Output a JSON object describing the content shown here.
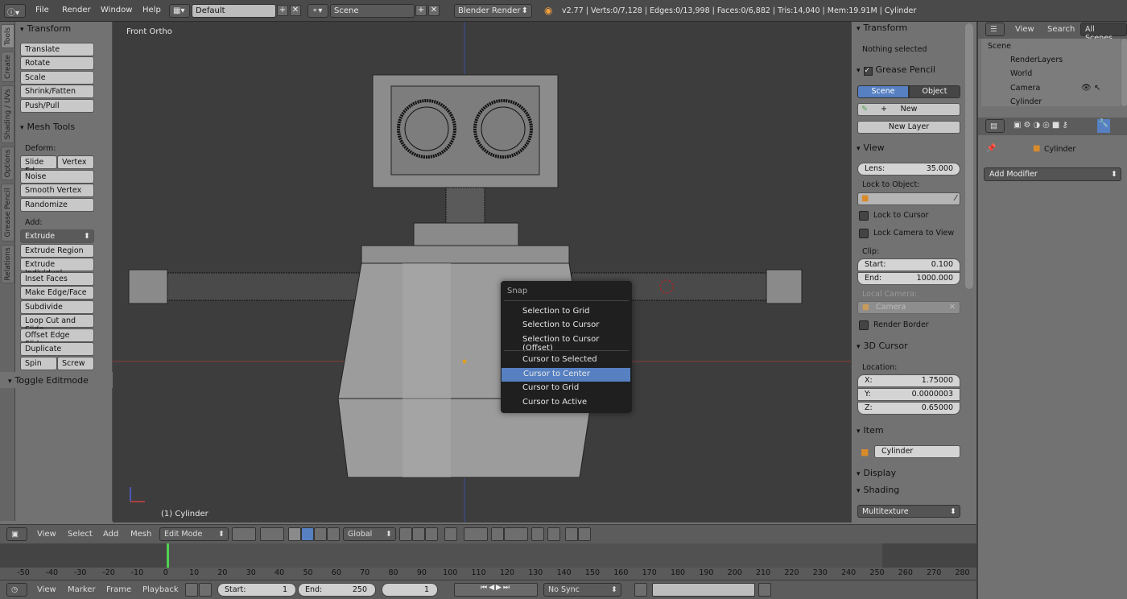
{
  "topbar": {
    "menus": [
      "File",
      "Render",
      "Window",
      "Help"
    ],
    "screen_layout": "Default",
    "scene": "Scene",
    "render_engine": "Blender Render",
    "stats": "v2.77 | Verts:0/7,128 | Edges:0/13,998 | Faces:0/6,882 | Tris:14,040 | Mem:19.91M | Cylinder"
  },
  "vertical_tabs": [
    "Tools",
    "Create",
    "Shading / UVs",
    "Options",
    "Grease Pencil",
    "Relations"
  ],
  "toolshelf": {
    "transform_title": "Transform",
    "transform_buttons": [
      "Translate",
      "Rotate",
      "Scale",
      "Shrink/Fatten",
      "Push/Pull"
    ],
    "mesh_tools_title": "Mesh Tools",
    "deform_label": "Deform:",
    "slide_edge": "Slide Ed",
    "vertex": "Vertex",
    "deform_buttons": [
      "Noise",
      "Smooth Vertex",
      "Randomize"
    ],
    "add_label": "Add:",
    "extrude": "Extrude",
    "add_buttons": [
      "Extrude Region",
      "Extrude Individual",
      "Inset Faces",
      "Make Edge/Face",
      "Subdivide",
      "Loop Cut and Slide",
      "Offset Edge Slide",
      "Duplicate"
    ],
    "spin": "Spin",
    "screw": "Screw",
    "toggle_editmode": "Toggle Editmode"
  },
  "viewport": {
    "view_name": "Front Ortho",
    "object_label": "(1) Cylinder"
  },
  "snap_menu": {
    "title": "Snap",
    "items": [
      "Selection to Grid",
      "Selection to Cursor",
      "Selection to Cursor (Offset)",
      "Cursor to Selected",
      "Cursor to Center",
      "Cursor to Grid",
      "Cursor to Active"
    ],
    "highlighted": "Cursor to Center"
  },
  "npanel": {
    "transform_title": "Transform",
    "nothing_selected": "Nothing selected",
    "grease_pencil_title": "Grease Pencil",
    "scene_btn": "Scene",
    "object_btn": "Object",
    "new_btn": "New",
    "new_layer_btn": "New Layer",
    "view_title": "View",
    "lens_label": "Lens:",
    "lens_value": "35.000",
    "lock_to_object": "Lock to Object:",
    "lock_to_cursor": "Lock to Cursor",
    "lock_camera": "Lock Camera to View",
    "clip_label": "Clip:",
    "clip_start_label": "Start:",
    "clip_start": "0.100",
    "clip_end_label": "End:",
    "clip_end": "1000.000",
    "local_camera": "Local Camera:",
    "camera_value": "Camera",
    "render_border": "Render Border",
    "cursor_title": "3D Cursor",
    "location_label": "Location:",
    "x_label": "X:",
    "x_value": "1.75000",
    "y_label": "Y:",
    "y_value": "0.0000003",
    "z_label": "Z:",
    "z_value": "0.65000",
    "item_title": "Item",
    "item_name": "Cylinder",
    "display_title": "Display",
    "shading_title": "Shading",
    "shading_mode": "Multitexture"
  },
  "outliner": {
    "view_menu": "View",
    "search_menu": "Search",
    "filter": "All Scenes",
    "rows": [
      "Scene",
      "RenderLayers",
      "World",
      "Camera",
      "Cylinder"
    ]
  },
  "properties": {
    "context_object": "Cylinder",
    "add_modifier": "Add Modifier"
  },
  "view_header": {
    "menus": [
      "View",
      "Select",
      "Add",
      "Mesh"
    ],
    "mode": "Edit Mode",
    "orientation": "Global"
  },
  "ruler_ticks": [
    "-50",
    "-40",
    "-30",
    "-20",
    "-10",
    "0",
    "10",
    "20",
    "30",
    "40",
    "50",
    "60",
    "70",
    "80",
    "90",
    "100",
    "110",
    "120",
    "130",
    "140",
    "150",
    "160",
    "170",
    "180",
    "190",
    "200",
    "210",
    "220",
    "230",
    "240",
    "250",
    "260",
    "270",
    "280"
  ],
  "timeline_header": {
    "menus": [
      "View",
      "Marker",
      "Frame",
      "Playback"
    ],
    "start_label": "Start:",
    "start_value": "1",
    "end_label": "End:",
    "end_value": "250",
    "current_frame": "1",
    "sync": "No Sync"
  },
  "colors": {
    "accent": "#5680c2",
    "viewport_bg": "#3d3d3d",
    "panel_bg": "#727272"
  }
}
